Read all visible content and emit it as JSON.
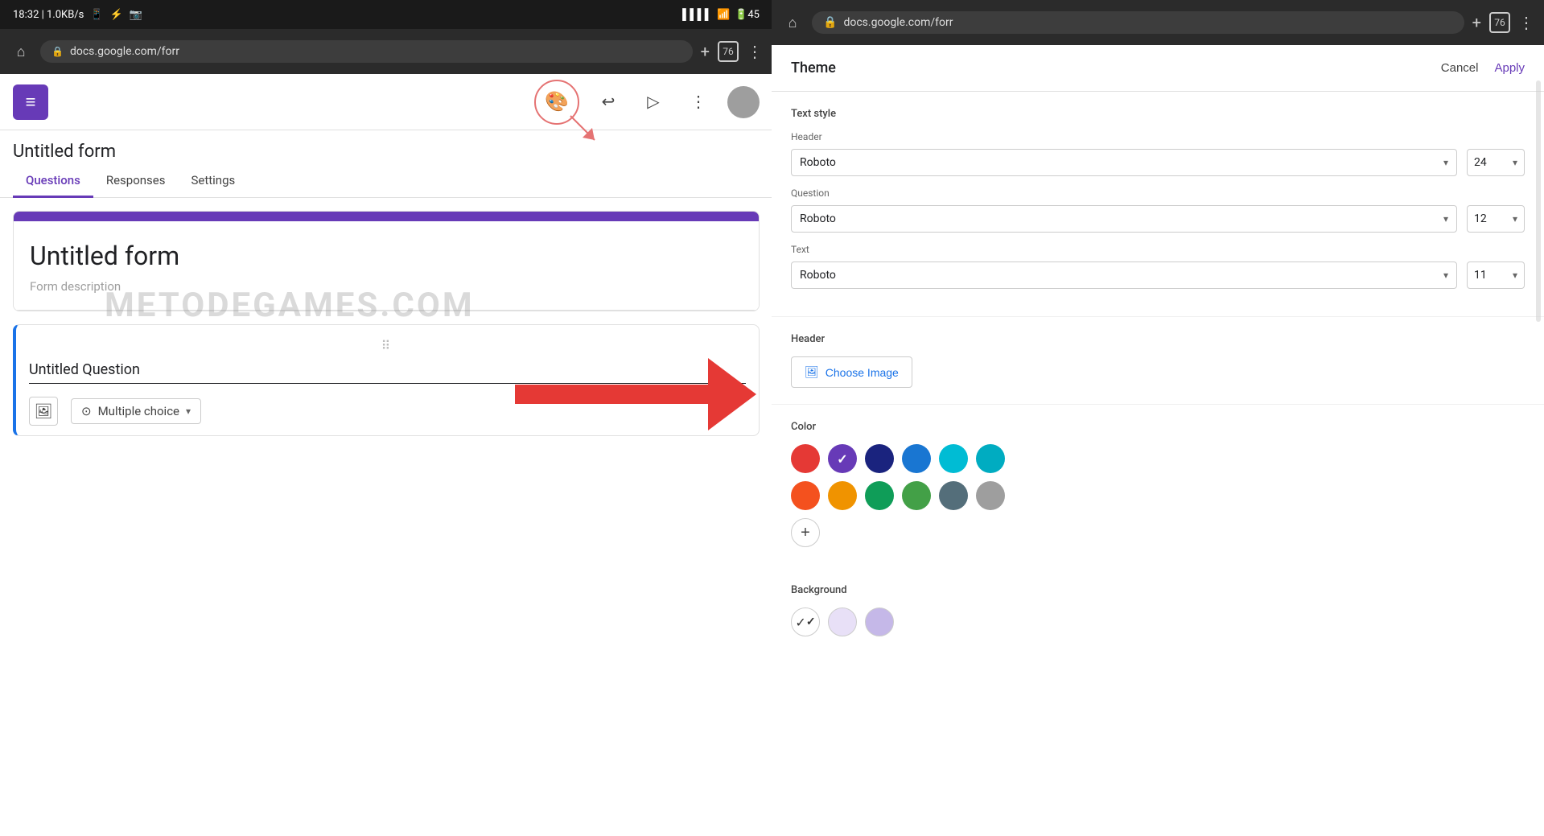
{
  "left": {
    "statusBar": {
      "time": "18:32 | 1.0KB/s",
      "icons": "📶 📶 🔋45"
    },
    "browserUrl": "docs.google.com/forr",
    "tabCount": "76",
    "formTitle": "Untitled form",
    "tabs": [
      {
        "label": "Questions",
        "active": true
      },
      {
        "label": "Responses",
        "active": false
      },
      {
        "label": "Settings",
        "active": false
      }
    ],
    "formContent": {
      "title": "Untitled form",
      "description": "Form description"
    },
    "question": {
      "text": "Untitled Question",
      "type": "Multiple choice"
    },
    "watermark": "METODEGAMES.COM"
  },
  "right": {
    "browserUrl": "docs.google.com/forr",
    "tabCount": "76",
    "theme": {
      "title": "Theme",
      "cancelLabel": "Cancel",
      "applyLabel": "Apply",
      "textStyleLabel": "Text style",
      "headerLabel": "Header",
      "questionLabel": "Question",
      "textLabel": "Text",
      "headerSectionLabel": "Header",
      "chooseImageLabel": "Choose Image",
      "colorLabel": "Color",
      "backgroundLabel": "Background",
      "fonts": [
        {
          "name": "Roboto",
          "size": "24"
        },
        {
          "name": "Roboto",
          "size": "12"
        },
        {
          "name": "Roboto",
          "size": "11"
        }
      ],
      "colors": [
        {
          "hex": "#e53935",
          "selected": false
        },
        {
          "hex": "#673ab7",
          "selected": true
        },
        {
          "hex": "#1a237e",
          "selected": false
        },
        {
          "hex": "#1976d2",
          "selected": false
        },
        {
          "hex": "#00bcd4",
          "selected": false
        },
        {
          "hex": "#00acc1",
          "selected": false
        },
        {
          "hex": "#f4511e",
          "selected": false
        },
        {
          "hex": "#f09300",
          "selected": false
        },
        {
          "hex": "#0f9d58",
          "selected": false
        },
        {
          "hex": "#43a047",
          "selected": false
        },
        {
          "hex": "#546e7a",
          "selected": false
        },
        {
          "hex": "#9e9e9e",
          "selected": false
        }
      ]
    }
  }
}
